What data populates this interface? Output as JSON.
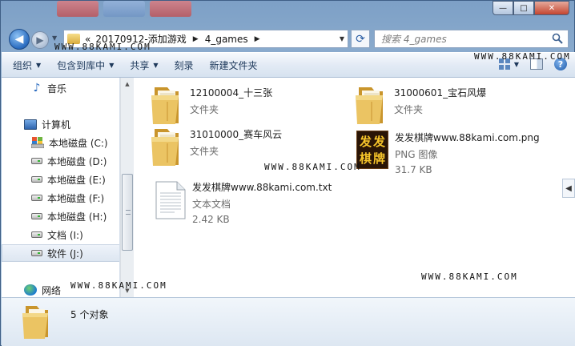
{
  "window": {
    "controls": {
      "minimize": "—",
      "maximize": "□",
      "close": "✕"
    }
  },
  "address": {
    "prefix": "«",
    "crumbs": [
      "20170912-添加游戏",
      "4_games"
    ]
  },
  "search": {
    "placeholder": "搜索 4_games"
  },
  "toolbar": {
    "items": [
      {
        "label": "组织",
        "dropdown": true
      },
      {
        "label": "包含到库中",
        "dropdown": true
      },
      {
        "label": "共享",
        "dropdown": true
      },
      {
        "label": "刻录",
        "dropdown": false
      },
      {
        "label": "新建文件夹",
        "dropdown": false
      }
    ]
  },
  "nav": {
    "music": "音乐",
    "computer": "计算机",
    "drives": [
      "本地磁盘 (C:)",
      "本地磁盘 (D:)",
      "本地磁盘 (E:)",
      "本地磁盘 (F:)",
      "本地磁盘 (H:)",
      "文档 (I:)",
      "软件 (J:)"
    ],
    "selected_drive": "软件 (J:)",
    "network": "网络"
  },
  "files": [
    {
      "name": "12100004_十三张",
      "type": "文件夹",
      "size": "",
      "icon": "folder-icon"
    },
    {
      "name": "31000601_宝石风爆",
      "type": "文件夹",
      "size": "",
      "icon": "folder-icon"
    },
    {
      "name": "31010000_赛车风云",
      "type": "文件夹",
      "size": "",
      "icon": "folder-icon"
    },
    {
      "name": "发发棋牌www.88kami.com.png",
      "type": "PNG 图像",
      "size": "31.7 KB",
      "icon": "image-icon",
      "thumbnail_text": [
        "发",
        "发",
        "棋",
        "牌"
      ]
    },
    {
      "name": "发发棋牌www.88kami.com.txt",
      "type": "文本文档",
      "size": "2.42 KB",
      "icon": "text-file-icon"
    }
  ],
  "details": {
    "count": "5 个对象"
  },
  "watermark": {
    "a": "WWW.88KAMI.COM",
    "b": "WWW.88KAMI.COM",
    "c": "WWW.88KAMI.COM",
    "d": "WWW.88KAMI.COM",
    "e": "WWW.88KAMI.COM"
  },
  "colors": {
    "frame": "#9fbcd9",
    "toolbar_text": "#1e395b",
    "folder": "#e3b54a",
    "secondary_text": "#6d6d6d"
  }
}
